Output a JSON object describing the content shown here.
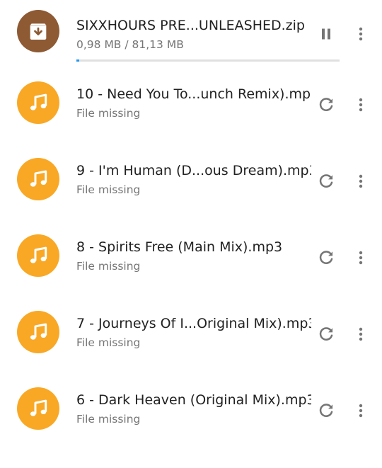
{
  "colors": {
    "archive_avatar": "#8d5a34",
    "music_avatar": "#f9a825",
    "progress_fill": "#2196f3",
    "progress_track": "#e0e0e0",
    "icon_gray": "#757575"
  },
  "active_download": {
    "filename": "SIXXHOURS PRE...UNLEASHED.zip",
    "progress_text": "0,98 MB / 81,13 MB",
    "progress_fraction": 0.012,
    "icon": "archive-download-icon",
    "action_icon": "pause-icon",
    "menu_icon": "more-vert-icon"
  },
  "items": [
    {
      "filename": "10 - Need You To...unch Remix).mp3",
      "status": "File missing",
      "icon": "music-note-icon",
      "action_icon": "retry-icon"
    },
    {
      "filename": "9 - I'm Human (D...ous Dream).mp3",
      "status": "File missing",
      "icon": "music-note-icon",
      "action_icon": "retry-icon"
    },
    {
      "filename": "8 - Spirits Free (Main Mix).mp3",
      "status": "File missing",
      "icon": "music-note-icon",
      "action_icon": "retry-icon"
    },
    {
      "filename": "7 - Journeys Of I...Original Mix).mp3",
      "status": "File missing",
      "icon": "music-note-icon",
      "action_icon": "retry-icon"
    },
    {
      "filename": "6 - Dark Heaven (Original Mix).mp3",
      "status": "File missing",
      "icon": "music-note-icon",
      "action_icon": "retry-icon"
    }
  ]
}
